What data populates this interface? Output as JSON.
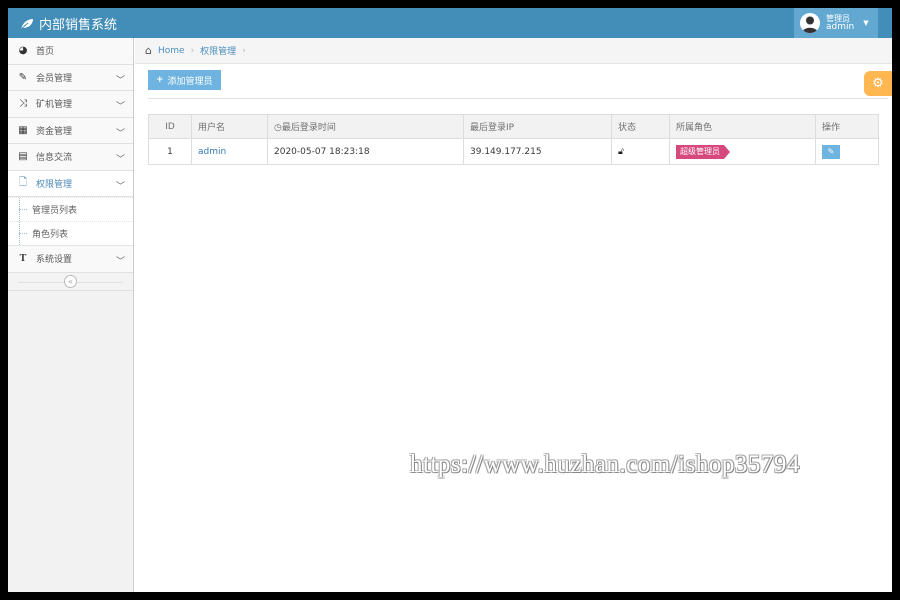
{
  "app": {
    "title": "内部销售系统"
  },
  "user": {
    "role": "管理员",
    "name": "admin"
  },
  "sidebar": {
    "items": [
      {
        "label": "首页",
        "icon": "dashboard-icon"
      },
      {
        "label": "会员管理",
        "icon": "pencil-square-icon"
      },
      {
        "label": "矿机管理",
        "icon": "random-icon"
      },
      {
        "label": "资金管理",
        "icon": "calendar-icon"
      },
      {
        "label": "信息交流",
        "icon": "list-alt-icon"
      },
      {
        "label": "权限管理",
        "icon": "file-icon"
      },
      {
        "label": "系统设置",
        "icon": "text-height-icon"
      }
    ],
    "submenu": [
      "管理员列表",
      "角色列表"
    ],
    "collapse_symbol": "«"
  },
  "breadcrumb": {
    "home": "Home",
    "current": "权限管理"
  },
  "toolbar": {
    "add_label": "添加管理员"
  },
  "table": {
    "headers": [
      "ID",
      "用户名",
      "最后登录时间",
      "最后登录IP",
      "状态",
      "所属角色",
      "操作"
    ],
    "rows": [
      {
        "id": "1",
        "username": "admin",
        "last_login": "2020-05-07 18:23:18",
        "ip": "39.149.177.215",
        "role": "超级管理员"
      }
    ]
  },
  "watermark": "https://www.huzhan.com/ishop35794",
  "colors": {
    "navbar": "#438eb9",
    "accent": "#6fb3e0",
    "badge": "#d6487e",
    "settings": "#ffb752"
  }
}
